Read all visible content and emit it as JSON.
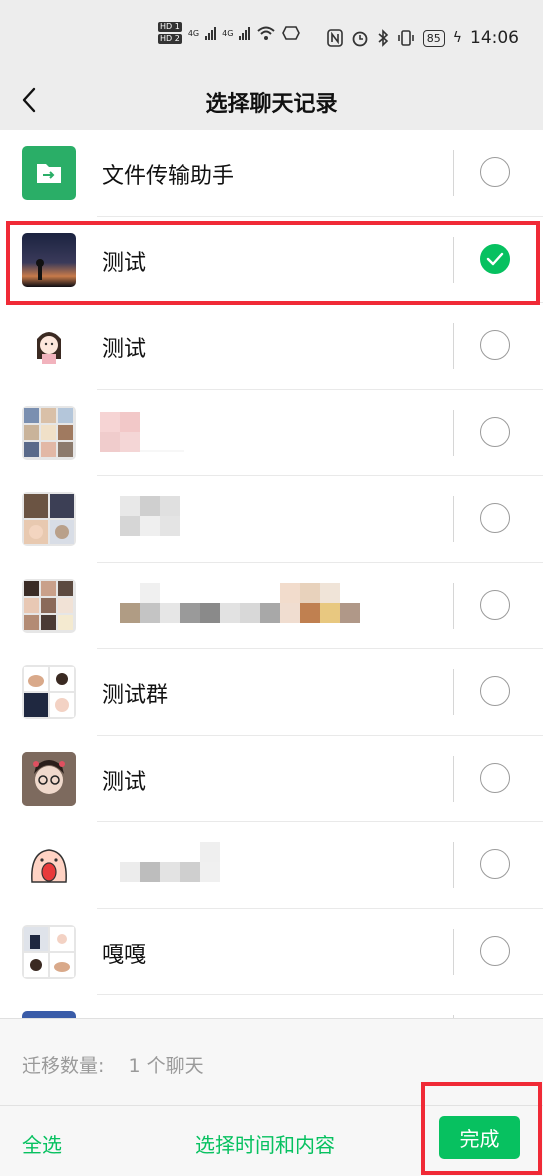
{
  "status_bar": {
    "hd_labels": [
      "HD 1",
      "HD 2"
    ],
    "net_labels": [
      "4G",
      "4G"
    ],
    "battery": "85",
    "time": "14:06"
  },
  "header": {
    "title": "选择聊天记录",
    "back_icon": "chevron-left-icon"
  },
  "chats": [
    {
      "name": "文件传输助手",
      "selected": false,
      "avatar": "file-transfer-icon"
    },
    {
      "name": "测试",
      "selected": true,
      "avatar": "photo-sunset-avatar"
    },
    {
      "name": "测试",
      "selected": false,
      "avatar": "cartoon-girl-avatar"
    },
    {
      "name": "",
      "selected": false,
      "avatar": "group-grid-avatar"
    },
    {
      "name": "",
      "selected": false,
      "avatar": "group-grid-avatar"
    },
    {
      "name": "",
      "selected": false,
      "avatar": "group-grid-avatar"
    },
    {
      "name": "测试群",
      "selected": false,
      "avatar": "group-grid-avatar"
    },
    {
      "name": "测试",
      "selected": false,
      "avatar": "selfie-avatar"
    },
    {
      "name": "",
      "selected": false,
      "avatar": "cartoon-screaming-avatar"
    },
    {
      "name": "嘎嘎",
      "selected": false,
      "avatar": "group-grid-avatar"
    }
  ],
  "footer": {
    "count_label": "迁移数量:",
    "count_value": "1 个聊天",
    "select_all": "全选",
    "choose_time": "选择时间和内容",
    "done": "完成"
  },
  "colors": {
    "accent": "#07c160",
    "highlight": "#f02a36",
    "background": "#ededed"
  }
}
